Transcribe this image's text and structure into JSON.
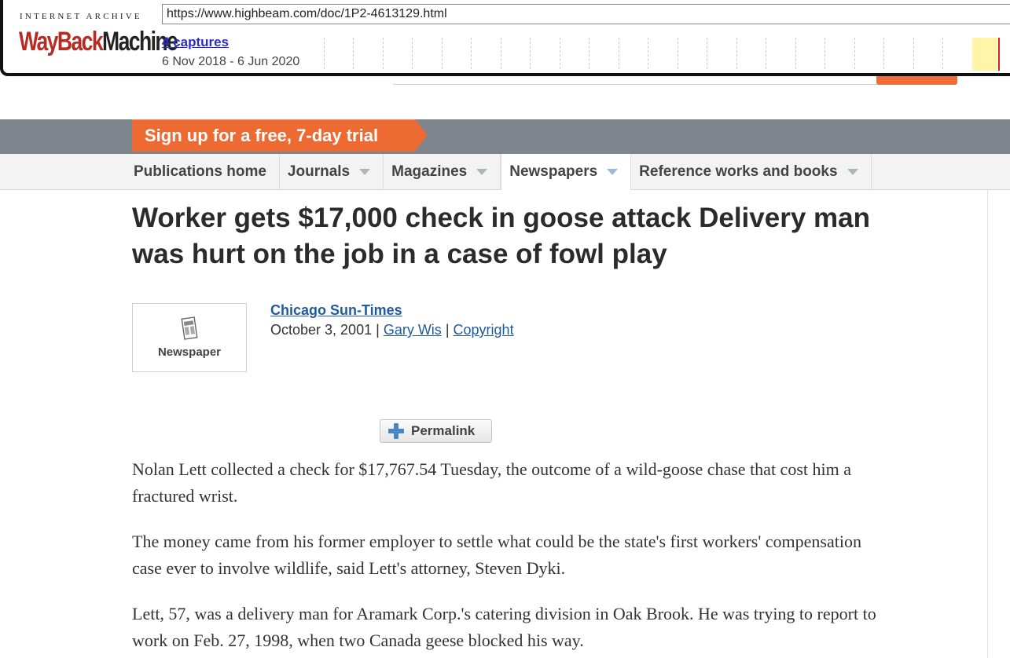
{
  "wayback": {
    "brand_top": "INTERNET ARCHIVE",
    "brand_way": "WayBack",
    "brand_machine": "Machine",
    "url": "https://www.highbeam.com/doc/1P2-4613129.html",
    "captures": "4 captures",
    "date_range": "6 Nov 2018 - 6 Jun 2020"
  },
  "banner": {
    "label": "Sign up for a free, 7-day trial"
  },
  "nav": {
    "items": [
      {
        "label": "Publications home",
        "dropdown": false
      },
      {
        "label": "Journals",
        "dropdown": true
      },
      {
        "label": "Magazines",
        "dropdown": true
      },
      {
        "label": "Newspapers",
        "dropdown": true,
        "active": true
      },
      {
        "label": "Reference works and books",
        "dropdown": true
      }
    ]
  },
  "article": {
    "headline": "Worker gets $17,000 check in goose attack Delivery man was hurt on the job in a case of fowl play",
    "pub_type": "Newspaper",
    "publication": "Chicago Sun-Times",
    "date": "October 3, 2001",
    "sep": "|",
    "author": "Gary Wis",
    "copyright": "Copyright",
    "permalink": "Permalink",
    "paragraphs": [
      "Nolan Lett collected a check for $17,767.54 Tuesday, the outcome of a wild-goose chase that cost him a fractured wrist.",
      "The money came from his former employer to settle what could be the state's first workers' compensation case ever to involve wildlife, said Lett's attorney, Steven Dyki.",
      "Lett, 57, was a delivery man for Aramark Corp.'s catering division in Oak Brook. He was trying to report to work on Feb. 27, 1998, when two Canada geese blocked his way."
    ]
  },
  "colors": {
    "accent_orange": "#ed6a32",
    "link_blue": "#1f5b9e",
    "band_gray": "#7f858c"
  }
}
